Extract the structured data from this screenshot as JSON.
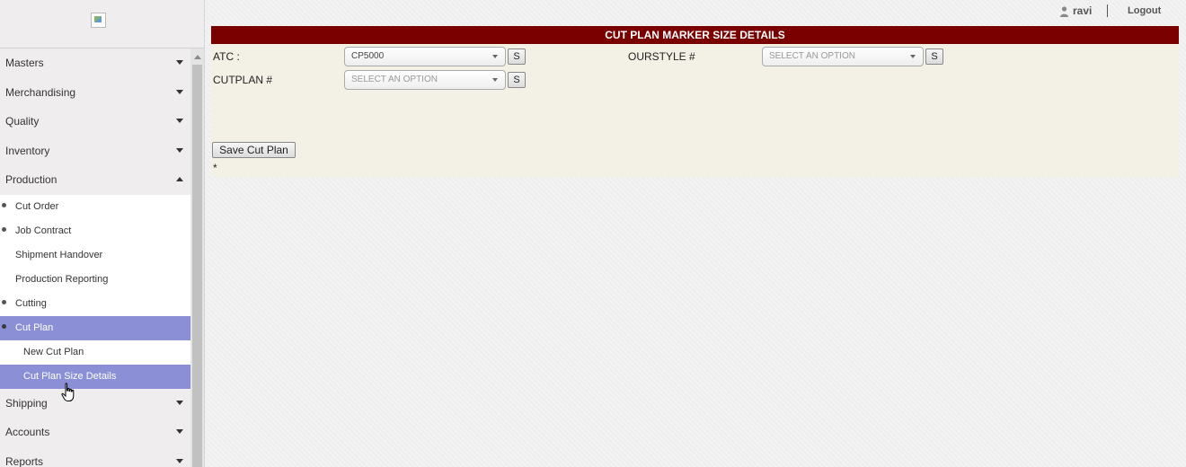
{
  "sidebar": {
    "logo_icon": "broken-image-icon",
    "menu": [
      {
        "label": "Masters",
        "state": "collapsed"
      },
      {
        "label": "Merchandising",
        "state": "collapsed"
      },
      {
        "label": "Quality",
        "state": "collapsed"
      },
      {
        "label": "Inventory",
        "state": "collapsed"
      },
      {
        "label": "Production",
        "state": "expanded"
      }
    ],
    "production_items": [
      {
        "label": "Cut Order"
      },
      {
        "label": "Job Contract"
      },
      {
        "label": "Shipment Handover"
      },
      {
        "label": "Production Reporting"
      },
      {
        "label": "Cutting"
      },
      {
        "label": "Cut Plan"
      }
    ],
    "cut_plan_items": [
      {
        "label": "New Cut Plan"
      },
      {
        "label": "Cut Plan Size Details"
      }
    ],
    "menu_after": [
      {
        "label": "Shipping",
        "state": "collapsed"
      },
      {
        "label": "Accounts",
        "state": "collapsed"
      },
      {
        "label": "Reports",
        "state": "collapsed"
      }
    ],
    "active_color": "#8a8fd6"
  },
  "header": {
    "user_icon": "user-icon",
    "username": "ravi",
    "separator": "|",
    "logout_label": "Logout"
  },
  "form": {
    "title": "CUT PLAN MARKER SIZE DETAILS",
    "title_bg": "#7a0000",
    "atc_label": "ATC  :",
    "atc_value": "CP5000",
    "ourstyle_label": "OURSTYLE  #",
    "ourstyle_value": "SELECT AN OPTION",
    "cutplan_label": "CUTPLAN #",
    "cutplan_value": "SELECT AN OPTION",
    "search_button_label": "S",
    "save_button_label": "Save  Cut Plan",
    "asterisk": "*"
  }
}
